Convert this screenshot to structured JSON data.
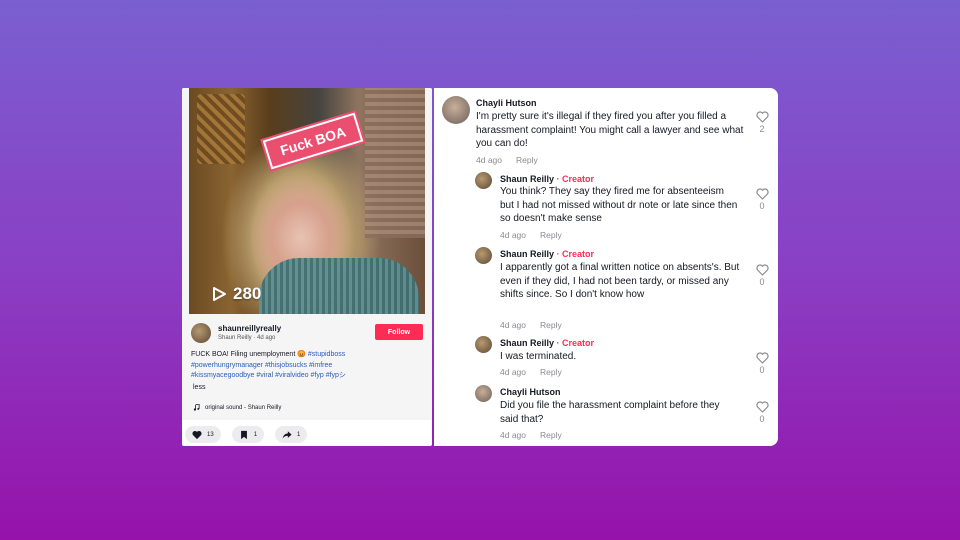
{
  "post": {
    "sticker_text": "Fuck BOA",
    "views": "280",
    "author_handle": "shaunreillyreally",
    "author_sub": "Shaun Reilly · 4d ago",
    "follow_label": "Follow",
    "caption_text": "FUCK BOA! Filing unemployment 😡 ",
    "hashtags": [
      "#stupidboss",
      "#powerhungrymanager",
      "#thisjobsucks",
      "#imfree",
      "#kissmyacegoodbye",
      "#viral",
      "#viralvideo",
      "#fyp",
      "#fypシ"
    ],
    "less_label": "less",
    "sound": "original sound - Shaun Reilly",
    "actions": {
      "likes": "13",
      "saves": "1",
      "shares": "1"
    }
  },
  "comments": [
    {
      "name": "Chayli Hutson",
      "creator_label": "",
      "text": "I'm pretty sure it's illegal if they fired you after you filled a harassment complaint! You might call a lawyer and see what you can do!",
      "time": "4d ago",
      "reply_label": "Reply",
      "likes": "2"
    },
    {
      "name": "Shaun Reilly",
      "creator_label": " · Creator",
      "text": "You think? They say they fired me for absenteeism but I had not missed without dr note or late since then so doesn't make sense",
      "time": "4d ago",
      "reply_label": "Reply",
      "likes": "0"
    },
    {
      "name": "Shaun Reilly",
      "creator_label": " · Creator",
      "text": "I apparently got a final written notice on absents's. But even if they did, I had not been tardy, or missed any shifts since. So I don't know how",
      "time": "4d ago",
      "reply_label": "Reply",
      "likes": "0"
    },
    {
      "name": "Shaun Reilly",
      "creator_label": " · Creator",
      "text": "I was terminated.",
      "time": "4d ago",
      "reply_label": "Reply",
      "likes": "0"
    },
    {
      "name": "Chayli Hutson",
      "creator_label": "",
      "text": "Did you file the harassment complaint before they said that?",
      "time": "4d ago",
      "reply_label": "Reply",
      "likes": "0"
    }
  ],
  "icons": {
    "play": "play-icon",
    "music": "music-note-icon",
    "like": "heart-icon",
    "save": "bookmark-icon",
    "share": "share-arrow-icon"
  },
  "colors": {
    "accent": "#fe2c55",
    "hashtag": "#2b5db9",
    "muted": "#8a8b91"
  }
}
